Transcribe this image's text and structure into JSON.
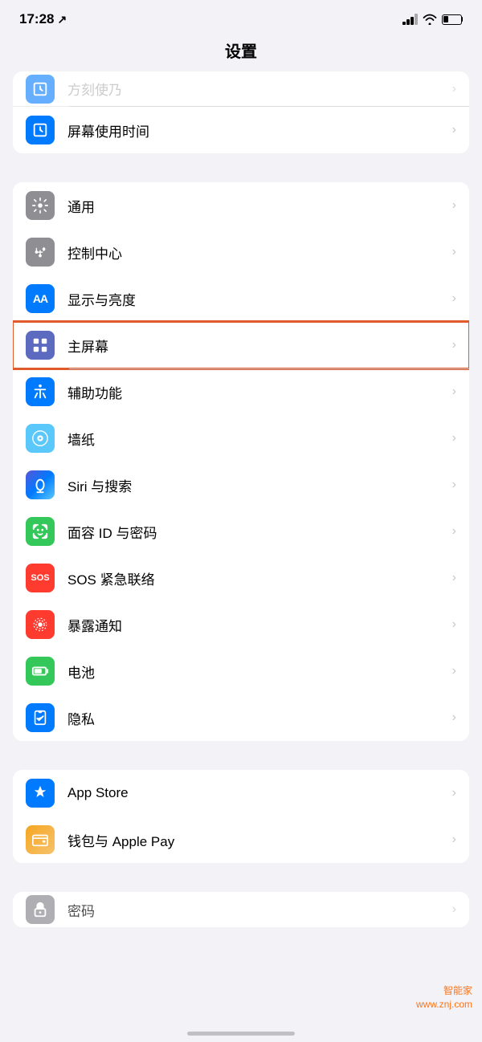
{
  "statusBar": {
    "time": "17:28",
    "arrow": "↗"
  },
  "pageTitle": "设置",
  "sections": [
    {
      "id": "top-partial",
      "items": [
        {
          "id": "screen-time-old",
          "icon": "hourglass",
          "iconBg": "blue",
          "label": "方刻使乃",
          "partial": true
        },
        {
          "id": "screen-time",
          "icon": "hourglass",
          "iconBg": "blue",
          "label": "屏幕使用时间"
        }
      ]
    },
    {
      "id": "general",
      "items": [
        {
          "id": "general-settings",
          "icon": "gear",
          "iconBg": "gray",
          "label": "通用"
        },
        {
          "id": "control-center",
          "icon": "sliders",
          "iconBg": "gray",
          "label": "控制中心"
        },
        {
          "id": "display",
          "icon": "AA",
          "iconBg": "blue",
          "label": "显示与亮度"
        },
        {
          "id": "home-screen",
          "icon": "grid",
          "iconBg": "indigo",
          "label": "主屏幕",
          "highlighted": true
        },
        {
          "id": "accessibility",
          "icon": "accessibility",
          "iconBg": "blue",
          "label": "辅助功能"
        },
        {
          "id": "wallpaper",
          "icon": "flower",
          "iconBg": "teal",
          "label": "墙纸"
        },
        {
          "id": "siri",
          "icon": "siri",
          "iconBg": "darkblue",
          "label": "Siri 与搜索"
        },
        {
          "id": "face-id",
          "icon": "faceid",
          "iconBg": "green",
          "label": "面容 ID 与密码"
        },
        {
          "id": "sos",
          "icon": "sos",
          "iconBg": "red",
          "label": "SOS 紧急联络"
        },
        {
          "id": "exposure",
          "icon": "exposure",
          "iconBg": "red",
          "label": "暴露通知"
        },
        {
          "id": "battery",
          "icon": "battery",
          "iconBg": "green",
          "label": "电池"
        },
        {
          "id": "privacy",
          "icon": "hand",
          "iconBg": "blue",
          "label": "隐私"
        }
      ]
    },
    {
      "id": "apps",
      "items": [
        {
          "id": "app-store",
          "icon": "appstore",
          "iconBg": "blue",
          "label": "App Store"
        },
        {
          "id": "wallet",
          "icon": "wallet",
          "iconBg": "yellow",
          "label": "钱包与 Apple Pay"
        }
      ]
    },
    {
      "id": "bottom-partial",
      "items": [
        {
          "id": "passwords",
          "icon": "key",
          "iconBg": "gray",
          "label": "密码",
          "partial": true
        }
      ]
    }
  ],
  "watermark": {
    "line1": "智能家",
    "line2": "www.znj.com"
  }
}
